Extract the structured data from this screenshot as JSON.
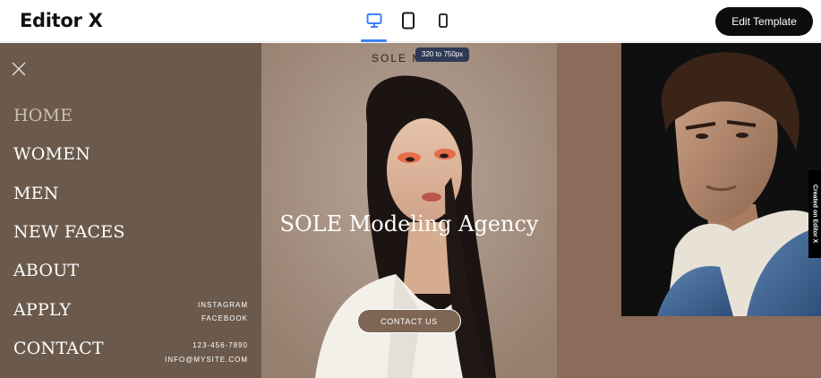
{
  "editor": {
    "logo": "Editor X",
    "edit_template_label": "Edit Template",
    "devices": [
      {
        "name": "desktop",
        "icon": "desktop-icon",
        "active": true
      },
      {
        "name": "tablet",
        "icon": "tablet-icon",
        "active": false
      },
      {
        "name": "mobile",
        "icon": "mobile-icon",
        "active": false
      }
    ],
    "breakpoint_tooltip": "320 to 750px",
    "side_tab": "Created on Editor X",
    "accent_color": "#3b82f6"
  },
  "site": {
    "brand": "SOLE MOD",
    "hero_title": "SOLE Modeling Agency",
    "cta_label": "CONTACT US",
    "menu": {
      "items": [
        {
          "label": "HOME",
          "active": true
        },
        {
          "label": "WOMEN",
          "active": false
        },
        {
          "label": "MEN",
          "active": false
        },
        {
          "label": "NEW FACES",
          "active": false
        },
        {
          "label": "ABOUT",
          "active": false
        },
        {
          "label": "APPLY",
          "active": false
        },
        {
          "label": "CONTACT",
          "active": false
        }
      ],
      "social": [
        "INSTAGRAM",
        "FACEBOOK"
      ],
      "contact": [
        "123-456-7890",
        "INFO@MYSITE.COM"
      ]
    },
    "colors": {
      "menu_bg": "#6b5a4c",
      "hero_bg": "#a79282",
      "right_bg": "#8c6b5a",
      "cta_bg": "#7e6554"
    }
  }
}
